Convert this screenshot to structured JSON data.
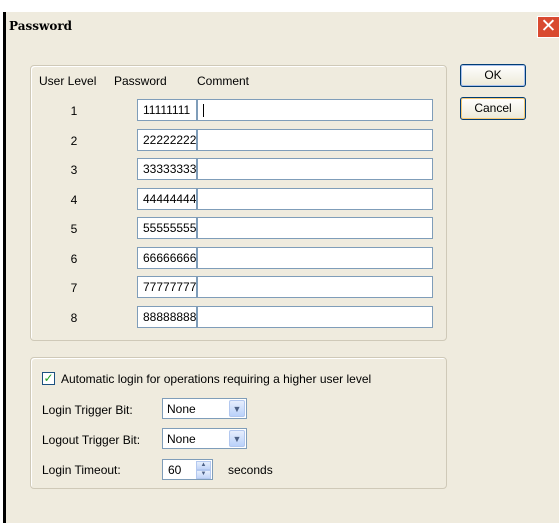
{
  "window": {
    "title": "Password",
    "close_glyph": "✕"
  },
  "table": {
    "headers": {
      "user_level": "User Level",
      "password": "Password",
      "comment": "Comment"
    },
    "rows": [
      {
        "level": "1",
        "password": "11111111",
        "comment": ""
      },
      {
        "level": "2",
        "password": "22222222",
        "comment": ""
      },
      {
        "level": "3",
        "password": "33333333",
        "comment": ""
      },
      {
        "level": "4",
        "password": "44444444",
        "comment": ""
      },
      {
        "level": "5",
        "password": "55555555",
        "comment": ""
      },
      {
        "level": "6",
        "password": "66666666",
        "comment": ""
      },
      {
        "level": "7",
        "password": "77777777",
        "comment": ""
      },
      {
        "level": "8",
        "password": "88888888",
        "comment": ""
      }
    ]
  },
  "buttons": {
    "ok": "OK",
    "cancel": "Cancel"
  },
  "login": {
    "auto_login": {
      "label": "Automatic login for operations requiring a higher user level",
      "checked": true,
      "check_glyph": "✓"
    },
    "login_trigger": {
      "label": "Login Trigger Bit:",
      "value": "None"
    },
    "logout_trigger": {
      "label": "Logout Trigger Bit:",
      "value": "None"
    },
    "timeout": {
      "label": "Login Timeout:",
      "value": "60",
      "unit": "seconds"
    }
  },
  "icons": {
    "close": "close-icon",
    "dropdown": "chevron-down-icon",
    "spin_up": "spin-up-icon",
    "spin_down": "spin-down-icon",
    "check": "checkmark-icon"
  },
  "colors": {
    "dialog_bg": "#efebde",
    "close_button": "#d94a30",
    "input_border": "#7f9db9",
    "check": "#21a121"
  }
}
